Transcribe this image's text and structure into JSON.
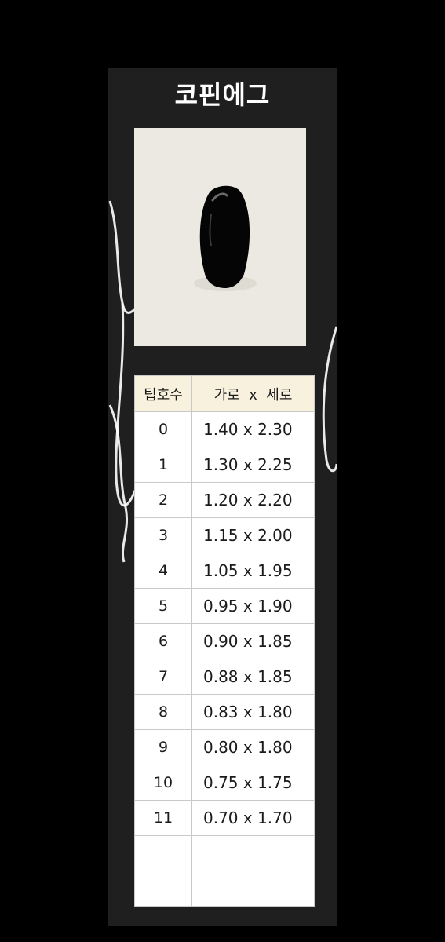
{
  "title": "코핀에그",
  "photo": {
    "subject": "black-coffin-nail-tip"
  },
  "table": {
    "headers": [
      "팁호수",
      "가로  x  세로"
    ],
    "rows": [
      {
        "tip": "0",
        "size": "1.40 x 2.30"
      },
      {
        "tip": "1",
        "size": "1.30 x 2.25"
      },
      {
        "tip": "2",
        "size": "1.20 x 2.20"
      },
      {
        "tip": "3",
        "size": "1.15 x 2.00"
      },
      {
        "tip": "4",
        "size": "1.05 x 1.95"
      },
      {
        "tip": "5",
        "size": "0.95 x 1.90"
      },
      {
        "tip": "6",
        "size": "0.90 x 1.85"
      },
      {
        "tip": "7",
        "size": "0.88 x 1.85"
      },
      {
        "tip": "8",
        "size": "0.83 x 1.80"
      },
      {
        "tip": "9",
        "size": "0.80 x 1.80"
      },
      {
        "tip": "10",
        "size": "0.75 x 1.75"
      },
      {
        "tip": "11",
        "size": "0.70 x 1.70"
      },
      {
        "tip": "",
        "size": ""
      },
      {
        "tip": "",
        "size": ""
      }
    ]
  },
  "colors": {
    "background": "#000000",
    "panel": "#1f1f1f",
    "header_fill": "#f7f1dd",
    "photo_bg": "#ece9e2"
  }
}
